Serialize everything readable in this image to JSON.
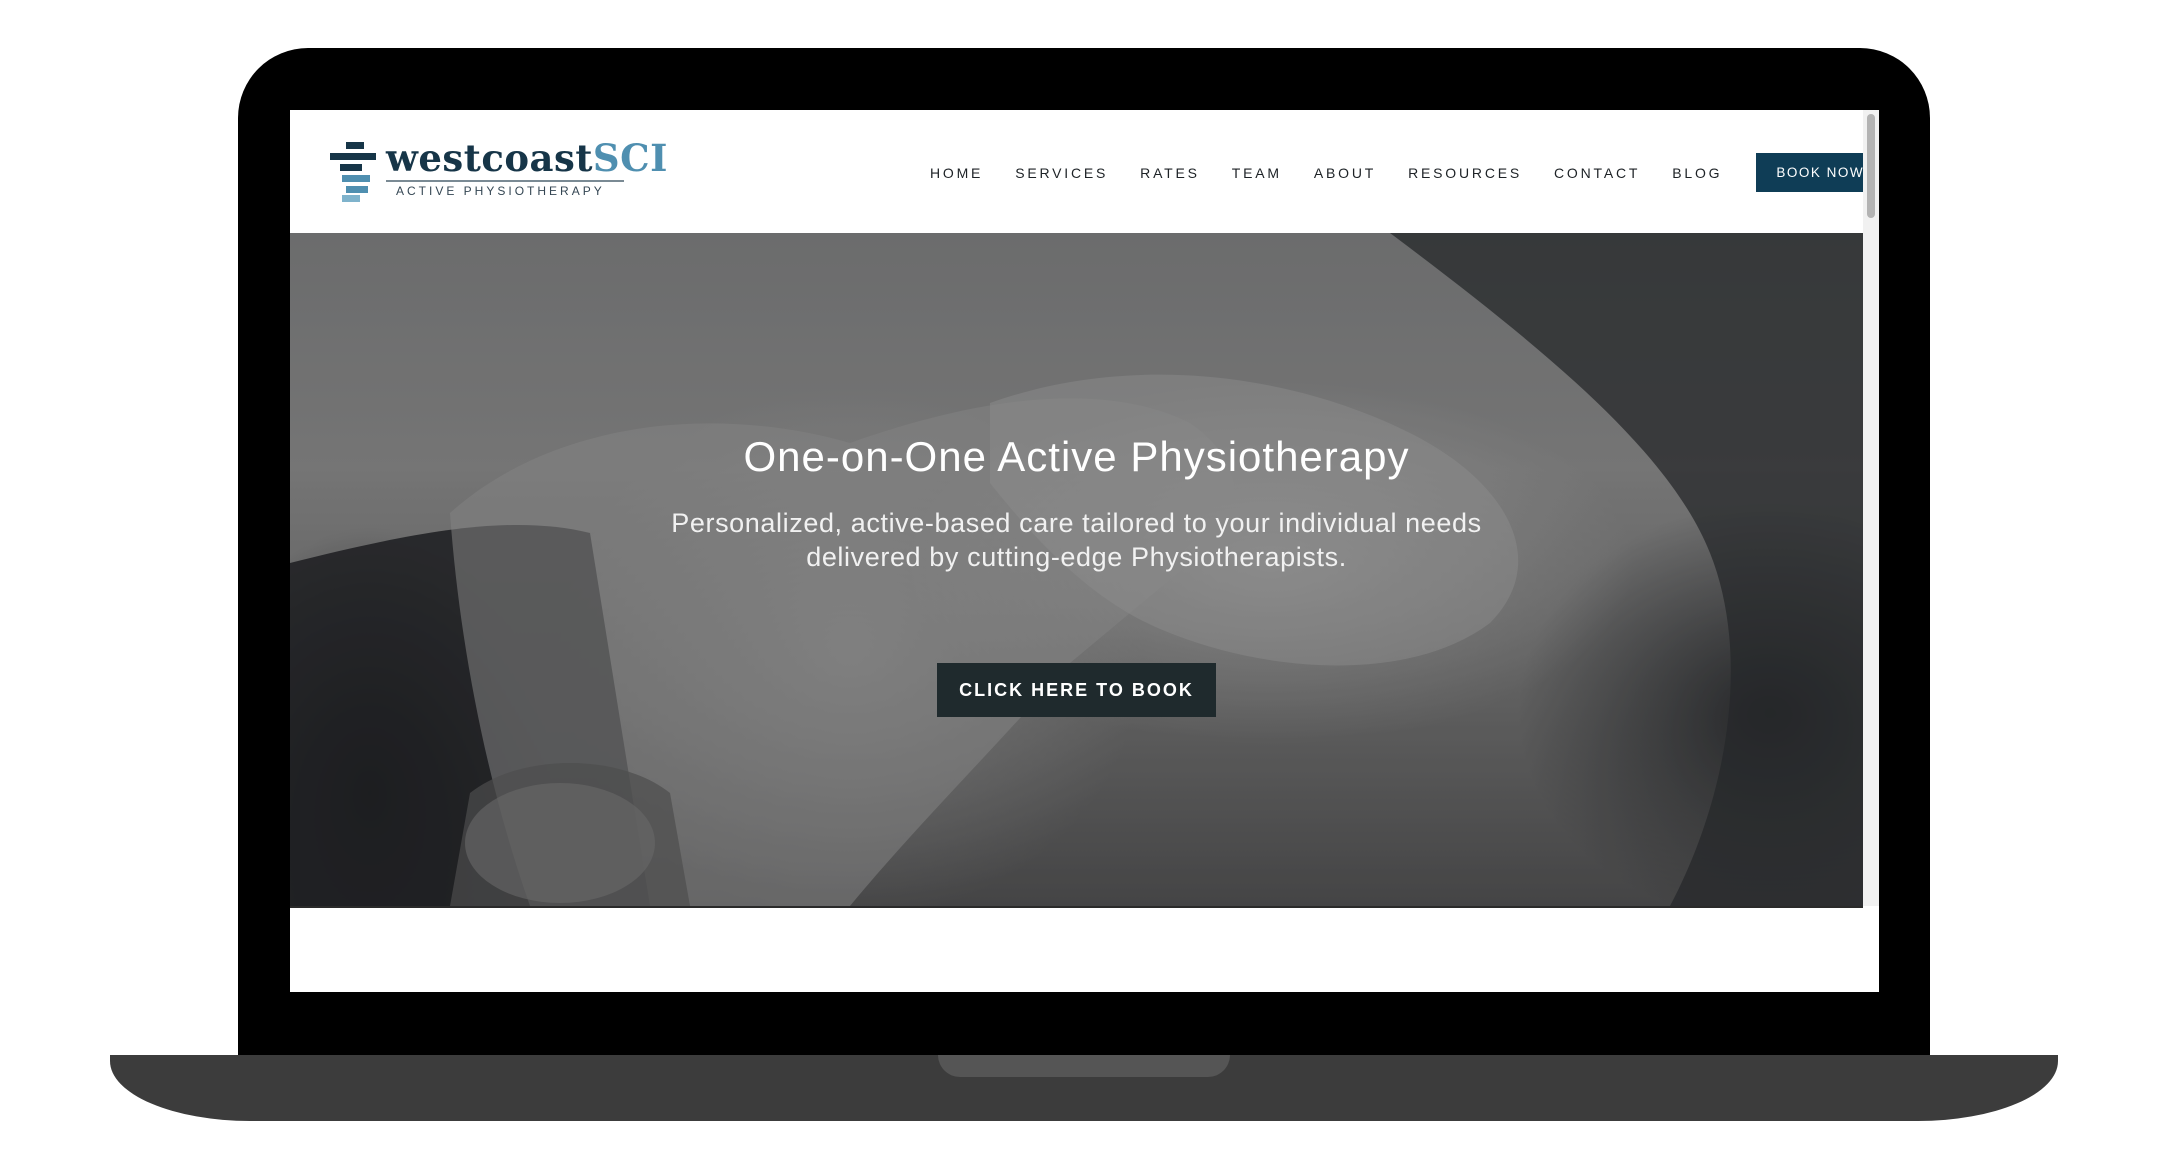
{
  "brand": {
    "name_main": "westcoast",
    "name_accent": "SCI",
    "tagline": "ACTIVE PHYSIOTHERAPY",
    "primary_color": "#163548",
    "accent_color": "#4f8fb0"
  },
  "nav": {
    "items": [
      "HOME",
      "SERVICES",
      "RATES",
      "TEAM",
      "ABOUT",
      "RESOURCES",
      "CONTACT",
      "BLOG"
    ],
    "cta_label": "BOOK NOW",
    "cta_color": "#0f3d56"
  },
  "hero": {
    "title": "One-on-One Active Physiotherapy",
    "subtitle_line1": "Personalized, active-based care tailored to your individual needs",
    "subtitle_line2": "delivered by cutting-edge Physiotherapists.",
    "cta_label": "CLICK HERE TO BOOK",
    "cta_color": "#1f2a2d"
  }
}
